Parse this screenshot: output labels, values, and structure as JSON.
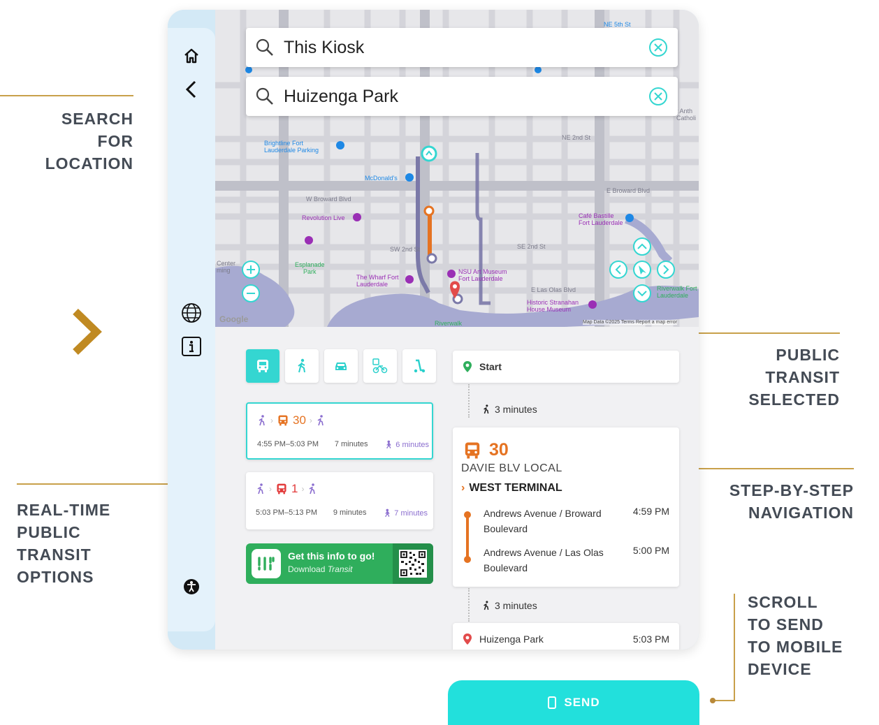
{
  "callouts": {
    "search": [
      "SEARCH",
      "FOR",
      "LOCATION"
    ],
    "public_transit": [
      "PUBLIC",
      "TRANSIT",
      "SELECTED"
    ],
    "realtime": [
      "REAL-TIME",
      "PUBLIC",
      "TRANSIT",
      "OPTIONS"
    ],
    "step_by_step": [
      "STEP-BY-STEP",
      "NAVIGATION"
    ],
    "scroll": [
      "SCROLL",
      "TO SEND",
      "TO MOBILE",
      "DEVICE"
    ]
  },
  "colors": {
    "accent": "#34d6d1",
    "gold": "#c8a04a",
    "route_orange": "#e57322",
    "poi_purple": "#9a2fb5",
    "transit_green": "#2fae5c"
  },
  "search": {
    "origin": "This Kiosk",
    "destination": "Huizenga Park"
  },
  "map": {
    "labels": {
      "brighton": "Brightline Fort\nLauderdale Parking",
      "mcdonalds": "McDonald's",
      "broward": "W Broward Blvd",
      "revolution": "Revolution Live",
      "wharf": "The Wharf Fort\nLauderdale",
      "nsu": "NSU Art Museum\nFort Lauderdale",
      "cafe": "Café Bastille\nFort Lauderdale",
      "stranahan": "Historic Stranahan\nHouse Museum",
      "esplanade": "Esplanade\nPark",
      "riverwalk": "Riverwalk",
      "riverwalk_fl": "Riverwalk Fort\nLauderdale",
      "lasolas": "E Las Olas Blvd",
      "center": "Center\nming",
      "ne2nd": "NE 2nd St",
      "sw2nd": "SW 2nd St",
      "se2nd": "SE 2nd St",
      "eb": "E Broward Blvd",
      "anth": "t Anth\nCatholi",
      "ne5th": "NE 5th St",
      "google": "Google",
      "attribution": "Map Data ©2025   Terms   Report a map error"
    }
  },
  "modes": [
    "transit-bus-icon",
    "walk-icon",
    "car-icon",
    "bike-share-icon",
    "scooter-icon"
  ],
  "options": [
    {
      "route": "30",
      "times": "4:55 PM–5:03 PM",
      "duration": "7 minutes",
      "walk": "6 minutes"
    },
    {
      "route": "1",
      "times": "5:03 PM–5:13 PM",
      "duration": "9 minutes",
      "walk": "7 minutes"
    }
  ],
  "promo": {
    "title": "Get this info to go!",
    "subtitle_prefix": "Download ",
    "subtitle_brand": "Transit"
  },
  "steps": {
    "start": "Start",
    "walk1": "3 minutes",
    "route_number": "30",
    "route_name": "DAVIE BLV LOCAL",
    "direction": "WEST TERMINAL",
    "stop1_name": "Andrews Avenue / Broward",
    "stop1_name2": "Boulevard",
    "stop1_time": "4:59 PM",
    "stop2_name": "Andrews Avenue / Las Olas",
    "stop2_name2": "Boulevard",
    "stop2_time": "5:00 PM",
    "walk2": "3 minutes",
    "end": "Huizenga Park",
    "end_time": "5:03 PM"
  },
  "send": {
    "label": "SEND"
  }
}
